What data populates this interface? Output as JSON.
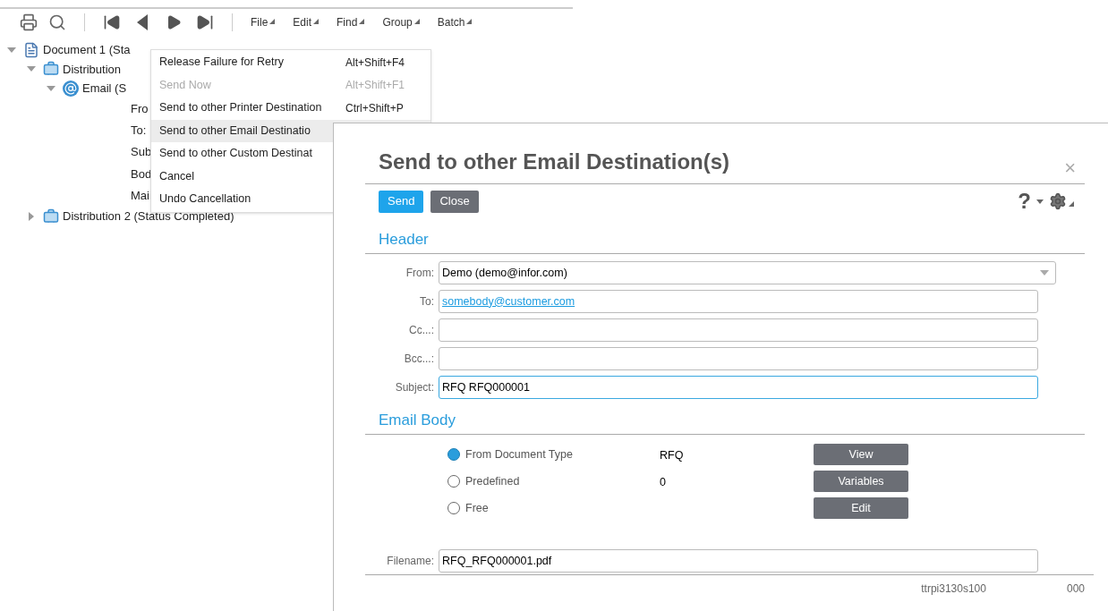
{
  "toolbar": {
    "menus": [
      "File",
      "Edit",
      "Find",
      "Group",
      "Batch"
    ]
  },
  "tree": [
    {
      "label": "Document 1 (Sta",
      "expanded": true,
      "kind": "document",
      "children": [
        {
          "label": "Distribution",
          "expanded": true,
          "kind": "distribution",
          "children": [
            {
              "label": "Email (S",
              "expanded": true,
              "kind": "email",
              "children": [
                {
                  "label": "Fro",
                  "kind": "field"
                },
                {
                  "label": "To:",
                  "kind": "field"
                },
                {
                  "label": "Sub",
                  "kind": "field"
                },
                {
                  "label": "Bod",
                  "kind": "field"
                },
                {
                  "label": "Mai",
                  "kind": "field"
                }
              ]
            }
          ]
        },
        {
          "label": "Distribution 2 (Status Completed)",
          "expanded": false,
          "kind": "distribution"
        }
      ]
    }
  ],
  "context_menu": {
    "items": [
      {
        "label": "Release Failure for Retry",
        "shortcut": "Alt+Shift+F4",
        "disabled": false,
        "selected": false
      },
      {
        "label": "Send Now",
        "shortcut": "Alt+Shift+F1",
        "disabled": true,
        "selected": false
      },
      {
        "label": "Send to other Printer Destination",
        "shortcut": "Ctrl+Shift+P",
        "disabled": false,
        "selected": false
      },
      {
        "label": "Send to other Email Destinatio",
        "disabled": false,
        "selected": true
      },
      {
        "label": "Send to other Custom Destinat",
        "disabled": false,
        "selected": false
      },
      {
        "label": "Cancel",
        "disabled": false,
        "selected": false
      },
      {
        "label": "Undo Cancellation",
        "disabled": false,
        "selected": false
      }
    ]
  },
  "dialog": {
    "title": "Send to other Email Destination(s)",
    "close": "×",
    "buttons": [
      {
        "label": "Send",
        "kind": "primary"
      },
      {
        "label": "Close",
        "kind": "secondary"
      }
    ],
    "help": "?",
    "header": {
      "title": "Header",
      "fields": [
        {
          "label": "From:",
          "value": "Demo (demo@infor.com)",
          "kind": "select",
          "focused": false
        },
        {
          "label": "To:",
          "value": "somebody@customer.com",
          "kind": "link",
          "focused": false
        },
        {
          "label": "Cc...:",
          "kind": "text",
          "focused": false
        },
        {
          "label": "Bcc...:",
          "kind": "text",
          "focused": false
        },
        {
          "label": "Subject:",
          "value": "RFQ RFQ000001",
          "kind": "text",
          "focused": true
        }
      ]
    },
    "email_body": {
      "title": "Email Body",
      "options": [
        {
          "label": "From Document Type",
          "value": "RFQ",
          "selected": true,
          "button": "View"
        },
        {
          "label": "Predefined",
          "value": "0",
          "selected": false,
          "button": "Variables"
        },
        {
          "label": "Free",
          "selected": false,
          "button": "Edit"
        }
      ]
    },
    "filename": {
      "label": "Filename:",
      "value": "RFQ_RFQ000001.pdf"
    },
    "footer": [
      "ttrpi3130s100",
      "000"
    ]
  }
}
